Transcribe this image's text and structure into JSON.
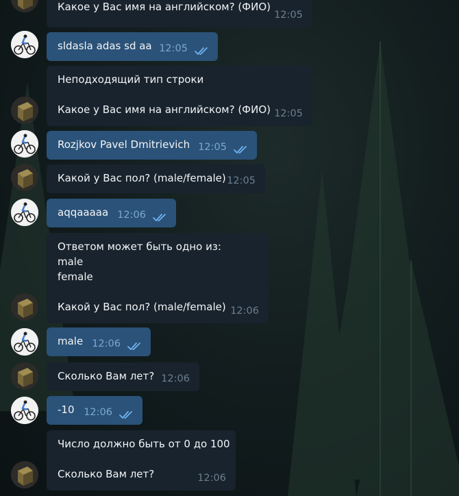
{
  "chat": {
    "messages": [
      {
        "sender": "bot",
        "lines": [
          "Какое у Вас имя на английском? (ФИО)"
        ],
        "time": "12:05"
      },
      {
        "sender": "user",
        "text": "sldasla adas sd aa",
        "time": "12:05"
      },
      {
        "sender": "bot",
        "lines": [
          "Неподходящий тип строки",
          "",
          "Какое у Вас имя на английском? (ФИО)"
        ],
        "time": "12:05"
      },
      {
        "sender": "user",
        "text": "Rozjkov Pavel Dmitrievich",
        "time": "12:05"
      },
      {
        "sender": "bot",
        "lines": [
          "Какой у Вас пол? (male/female)"
        ],
        "time": "12:05"
      },
      {
        "sender": "user",
        "text": "aqqaaaaa",
        "time": "12:06"
      },
      {
        "sender": "bot",
        "lines": [
          "Ответом может быть одно из:",
          "male",
          "female",
          "",
          "Какой у Вас пол? (male/female)"
        ],
        "time": "12:06"
      },
      {
        "sender": "user",
        "text": "male",
        "time": "12:06"
      },
      {
        "sender": "bot",
        "lines": [
          "Сколько Вам лет?"
        ],
        "time": "12:06"
      },
      {
        "sender": "user",
        "text": "-10",
        "time": "12:06"
      },
      {
        "sender": "bot",
        "lines": [
          "Число должно быть от 0 до 100",
          "",
          "Сколько Вам лет?"
        ],
        "time": "12:06"
      }
    ],
    "colors": {
      "user_bubble": "#2b5278",
      "bot_bubble": "#18232d",
      "check_color": "#6fb3f2",
      "background": "#131d1e"
    },
    "icons": {
      "read_receipt": "double-check-icon",
      "bot_avatar": "box-avatar",
      "user_avatar": "cyclist-avatar"
    }
  }
}
